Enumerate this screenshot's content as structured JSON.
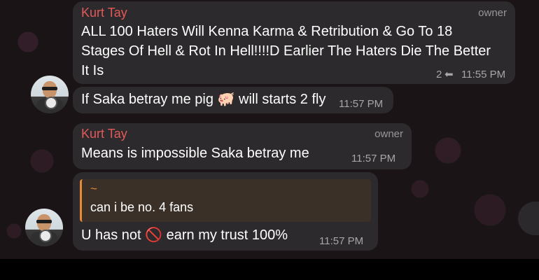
{
  "messages": [
    {
      "sender": "Kurt Tay",
      "role": "owner",
      "lines": [
        "ALL 100 Haters Will Kenna Karma & Retribution & Go To 18",
        "Stages Of Hell & Rot In Hell!!!!D Earlier The Haters Die The Better",
        "It Is"
      ],
      "reply_count": "2",
      "time": "11:55 PM"
    },
    {
      "text": "If Saka betray me pig 🐖 will starts 2 fly",
      "time": "11:57 PM"
    },
    {
      "sender": "Kurt Tay",
      "role": "owner",
      "text": "Means is impossible Saka betray me",
      "time": "11:57 PM"
    },
    {
      "quote": {
        "author": "~",
        "text": "can i be no. 4 fans"
      },
      "text": "U has not 🚫 earn my trust 100%",
      "time": "11:57 PM"
    }
  ],
  "colors": {
    "sender_name": "#e35a5a",
    "quote_accent": "#e98a3a",
    "bubble": "#2c2a2c",
    "background": "#1b1417"
  }
}
